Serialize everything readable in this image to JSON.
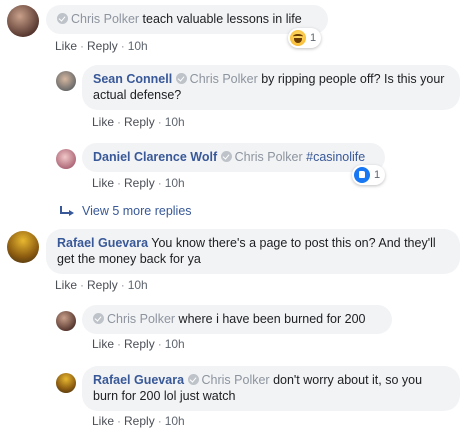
{
  "actions": {
    "like": "Like",
    "reply": "Reply",
    "sep": "·"
  },
  "comments": [
    {
      "author": "",
      "mention": "Chris Polker",
      "text": " teach valuable lessons in life",
      "time": "10h",
      "reaction": {
        "icon": "haha-reaction-icon",
        "count": "1"
      }
    },
    {
      "author": "Sean Connell",
      "mention": "Chris Polker",
      "text": " by ripping people off? Is this your actual defense?",
      "time": "10h"
    },
    {
      "author": "Daniel Clarence Wolf",
      "mention": "Chris Polker",
      "text": " #casinolife",
      "time": "10h",
      "reaction": {
        "icon": "like-reaction-icon",
        "count": "1"
      }
    },
    {
      "more_replies": "View 5 more replies"
    },
    {
      "author": "Rafael Guevara",
      "mention": "",
      "text": "You know there's a page to post this on? And they'll get the money back for ya",
      "time": "10h"
    },
    {
      "author": "",
      "mention": "Chris Polker",
      "text": " where i have been burned for 200",
      "time": "10h"
    },
    {
      "author": "Rafael Guevara",
      "mention": "Chris Polker",
      "text": " don't worry about it, so you burn for 200 lol just watch",
      "time": "10h"
    }
  ],
  "colors": {
    "link": "#385898",
    "bubble": "#f2f3f5",
    "mention_gray": "#8d949e",
    "meta": "#606770"
  }
}
